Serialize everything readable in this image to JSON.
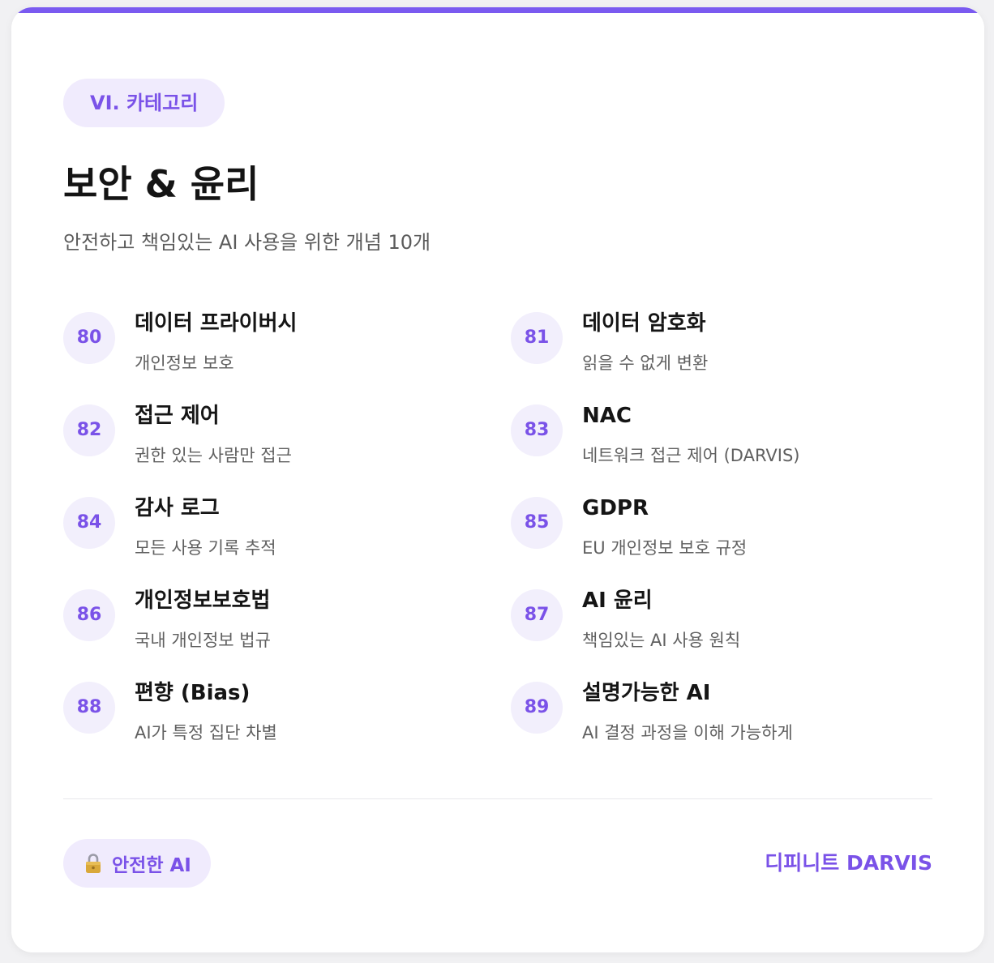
{
  "card": {
    "accent_color": "#7a5af0",
    "badge": "VI. 카테고리",
    "title": "보안 & 윤리",
    "subtitle": "안전하고 책임있는 AI 사용을 위한 개념 10개"
  },
  "concepts": [
    {
      "number": "80",
      "title": "데이터 프라이버시",
      "description": "개인정보 보호"
    },
    {
      "number": "81",
      "title": "데이터 암호화",
      "description": "읽을 수 없게 변환"
    },
    {
      "number": "82",
      "title": "접근 제어",
      "description": "권한 있는 사람만 접근"
    },
    {
      "number": "83",
      "title": "NAC",
      "description": "네트워크 접근 제어 (DARVIS)"
    },
    {
      "number": "84",
      "title": "감사 로그",
      "description": "모든 사용 기록 추적"
    },
    {
      "number": "85",
      "title": "GDPR",
      "description": "EU 개인정보 보호 규정"
    },
    {
      "number": "86",
      "title": "개인정보보호법",
      "description": "국내 개인정보 법규"
    },
    {
      "number": "87",
      "title": "AI 윤리",
      "description": "책임있는 AI 사용 원칙"
    },
    {
      "number": "88",
      "title": "편향 (Bias)",
      "description": "AI가 특정 집단 차별"
    },
    {
      "number": "89",
      "title": "설명가능한 AI",
      "description": "AI 결정 과정을 이해 가능하게"
    }
  ],
  "footer": {
    "badge_icon": "lock-icon",
    "badge_label": "안전한 AI",
    "brand": "디피니트 DARVIS"
  }
}
